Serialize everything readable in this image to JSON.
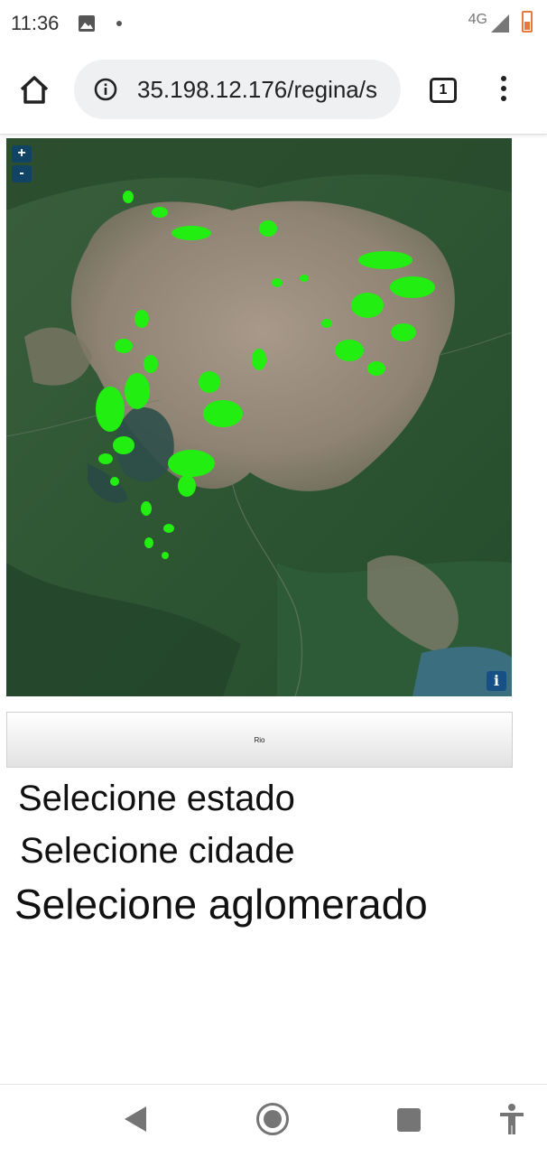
{
  "status_bar": {
    "time": "11:36",
    "network": "4G",
    "icons": [
      "image-notification-icon",
      "dot-icon",
      "signal-icon",
      "battery-icon"
    ]
  },
  "browser": {
    "url": "35.198.12.176/regina/s",
    "tab_count": "1",
    "icons": [
      "home-icon",
      "info-icon",
      "tabs-icon",
      "overflow-menu-icon"
    ]
  },
  "map": {
    "zoom_in": "+",
    "zoom_out": "-",
    "attribution": "i"
  },
  "city_button": {
    "label": "Rio"
  },
  "selectors": {
    "state": "Selecione estado",
    "city": "Selecione cidade",
    "cluster": "Selecione aglomerado"
  },
  "colors": {
    "overlay": "#22ee11",
    "forest": "#2c5a34",
    "urban": "#9a8a78",
    "water": "#3b6f80"
  },
  "nav_bar": {
    "icons": [
      "back-icon",
      "home-circle-icon",
      "recents-icon",
      "accessibility-icon"
    ]
  }
}
